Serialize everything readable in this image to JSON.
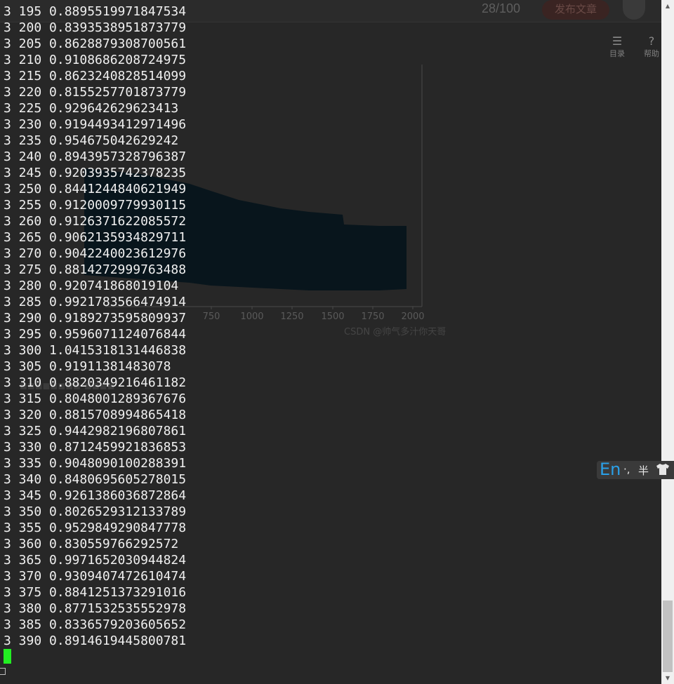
{
  "background_page": {
    "word_counter": "28/100",
    "publish_button": "发布文章",
    "toolbar": [
      {
        "label": "目录",
        "icon": "list-icon"
      },
      {
        "label": "帮助",
        "icon": "help-icon"
      }
    ],
    "watermark": "CSDN @帅气多汁你天哥",
    "chart_x_ticks": [
      "750",
      "1000",
      "1250",
      "1500",
      "1750",
      "2000"
    ]
  },
  "terminal": {
    "lines": [
      "3 195 0.8895519971847534",
      "3 200 0.8393538951873779",
      "3 205 0.8628879308700561",
      "3 210 0.9108686208724975",
      "3 215 0.8623240828514099",
      "3 220 0.8155257701873779",
      "3 225 0.929642629623413",
      "3 230 0.9194493412971496",
      "3 235 0.954675042629242",
      "3 240 0.8943957328796387",
      "3 245 0.9203935742378235",
      "3 250 0.8441244840621949",
      "3 255 0.9120009779930115",
      "3 260 0.9126371622085572",
      "3 265 0.9062135934829711",
      "3 270 0.9042240023612976",
      "3 275 0.8814272999763488",
      "3 280 0.920741868019104",
      "3 285 0.9921783566474914",
      "3 290 0.9189273595809937",
      "3 295 0.9596071124076844",
      "3 300 1.0415318131446838",
      "3 305 0.91911381483078",
      "3 310 0.8820349216461182",
      "3 315 0.8048001289367676",
      "3 320 0.8815708994865418",
      "3 325 0.9442982196807861",
      "3 330 0.8712459921836853",
      "3 335 0.9048090100288391",
      "3 340 0.8480695605278015",
      "3 345 0.9261386036872864",
      "3 350 0.8026529312133789",
      "3 355 0.9529849290847778",
      "3 360 0.830559766292572",
      "3 365 0.9971652030944824",
      "3 370 0.9309407472610474",
      "3 375 0.8841251373291016",
      "3 380 0.8771532535552978",
      "3 385 0.8336579203605652",
      "3 390 0.8914619445800781"
    ],
    "cursor_color": "#22ee22",
    "text_color": "#f0f0f0",
    "background_color": "#272727"
  },
  "ime": {
    "language": "En",
    "punctuation": "·,",
    "width_mode": "半",
    "skin_icon": "shirt-icon",
    "accent_color": "#2aa0e8"
  },
  "scrollbar": {
    "up_icon": "arrow-up-icon",
    "down_icon": "arrow-down-icon"
  }
}
